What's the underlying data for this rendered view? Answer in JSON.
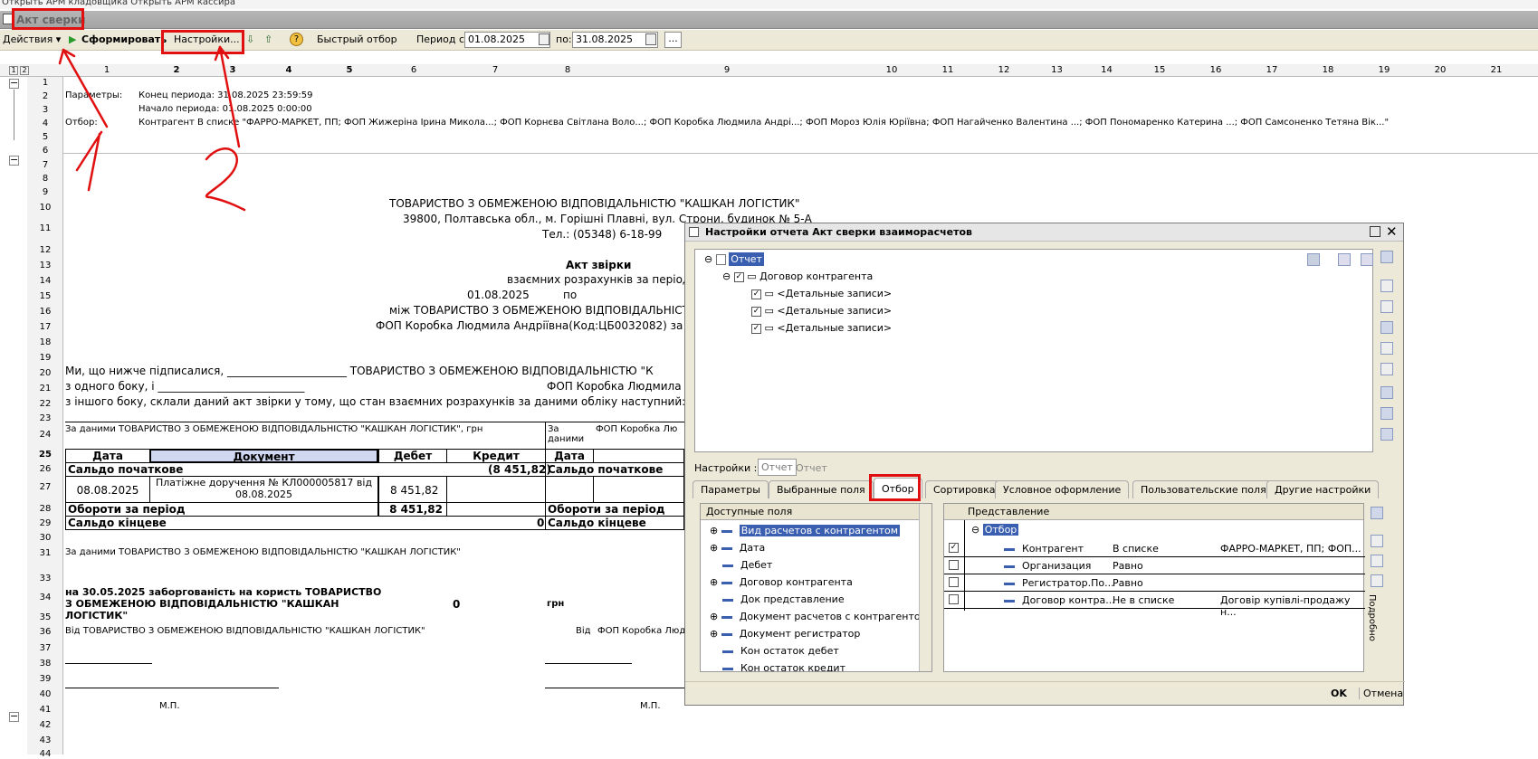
{
  "topbar": {
    "text": "Открыть АРМ кладовщика  Открыть АРМ кассира"
  },
  "window": {
    "title": "Акт сверки"
  },
  "toolbar": {
    "actions": "Действия",
    "form": "Сформировать",
    "settings": "Настройки...",
    "help": "?",
    "quick_filter": "Быстрый отбор",
    "period_from_label": "Период с:",
    "period_from": "01.08.2025",
    "period_to_label": "по:",
    "period_to": "31.08.2025",
    "more": "..."
  },
  "columns": [
    "1",
    "2",
    "3",
    "4",
    "5",
    "6",
    "7",
    "8",
    "9",
    "10",
    "11",
    "12",
    "13",
    "14",
    "15",
    "16",
    "17",
    "18",
    "19",
    "20",
    "21"
  ],
  "outline_levels": [
    "1",
    "2"
  ],
  "rows": [
    "1",
    "2",
    "3",
    "4",
    "5",
    "6",
    "7",
    "8",
    "9",
    "10",
    "11",
    "12",
    "13",
    "14",
    "15",
    "16",
    "17",
    "18",
    "19",
    "20",
    "21",
    "22",
    "23",
    "24",
    "25",
    "26",
    "27",
    "28",
    "29",
    "30",
    "31",
    "33",
    "34",
    "35",
    "36",
    "37",
    "38",
    "39",
    "40",
    "41",
    "42",
    "43",
    "44"
  ],
  "params": {
    "label": "Параметры:",
    "end": "Конец периода: 31.08.2025 23:59:59",
    "start": "Начало периода: 01.08.2025 0:00:00",
    "filter_label": "Отбор:",
    "filter": "Контрагент В списке \"ФАРРО-МАРКЕТ, ПП; ФОП Жижеріна Ірина Микола...; ФОП Корнєва Світлана Воло...; ФОП Коробка Людмила Андрі...; ФОП Мороз Юлія Юріївна; ФОП Нагайченко Валентина ...; ФОП Пономаренко Катерина ...; ФОП Самсоненко Тетяна Вік...\""
  },
  "doc": {
    "company": "ТОВАРИСТВО З ОБМЕЖЕНОЮ ВІДПОВІДАЛЬНІСТЮ \"КАШКАН ЛОГІСТИК\"",
    "address": "39800, Полтавська обл., м. Горішні Плавні, вул. Строни, будинок № 5-А",
    "phone": "Тел.: (05348) 6-18-99",
    "act_title": "Акт звірки",
    "act_sub": "взаємних розрахунків за період",
    "date_from": "01.08.2025",
    "date_to": "по",
    "between": "між ТОВАРИСТВО З ОБМЕЖЕНОЮ ВІДПОВІДАЛЬНІСТ",
    "counterparty": "ФОП Коробка Людмила Андріївна(Код:ЦБ0032082) за д",
    "para1a": "Ми, що нижче підписалися, ______________________ ТОВАРИСТВО З ОБМЕЖЕНОЮ ВІДПОВІДАЛЬНІСТЮ \"К",
    "para1b": " з одного боку, і ___________________________",
    "para1c": "ФОП Коробка Людмила А",
    "para1d": "з іншого боку, склали даний акт звірки у тому, що стан взаємних розрахунків за даними обліку наступний:",
    "left_hdr": "За даними ТОВАРИСТВО З ОБМЕЖЕНОЮ ВІДПОВІДАЛЬНІСТЮ \"КАШКАН ЛОГІСТИК\", грн",
    "right_hdr_a": "За даними",
    "right_hdr_b": "ФОП Коробка Лю",
    "col_date": "Дата",
    "col_doc": "Документ",
    "col_debit": "Дебет",
    "col_credit": "Кредит",
    "col_date2": "Дата",
    "saldo_start": "Сальдо початкове",
    "saldo_start_credit": "(8 451,82)",
    "row_date": "08.08.2025",
    "row_doc": "Платіжне доручення  № КЛ000005817 від 08.08.2025",
    "row_debit": "8 451,82",
    "turnover": "Обороти за період",
    "turnover_debit": "8 451,82",
    "saldo_end": "Сальдо кінцеве",
    "saldo_end_credit": "0",
    "by_data": "За даними ТОВАРИСТВО З ОБМЕЖЕНОЮ ВІДПОВІДАЛЬНІСТЮ \"КАШКАН ЛОГІСТИК\"",
    "debt": "на 30.05.2025 заборгованість на користь ТОВАРИСТВО З ОБМЕЖЕНОЮ ВІДПОВІДАЛЬНІСТЮ \"КАШКАН ЛОГІСТИК\"",
    "debt_val": "0",
    "debt_cur": "грн",
    "from_left": "Від ТОВАРИСТВО З ОБМЕЖЕНОЮ ВІДПОВІДАЛЬНІСТЮ \"КАШКАН ЛОГІСТИК\"",
    "from_right_a": "Від",
    "from_right_b": "ФОП Коробка Людм",
    "mp": "М.П.",
    "mp2": "М.П."
  },
  "dialog": {
    "title": "Настройки отчета  Акт сверки взаиморасчетов",
    "tree_root": "Отчет",
    "tree_group": "Договор контрагента",
    "tree_items": [
      "<Детальные записи>",
      "<Детальные записи>",
      "<Детальные записи>"
    ],
    "settings_label": "Настройки :",
    "settings_btn": "Отчет",
    "settings_val": "Отчет",
    "tabs": [
      "Параметры",
      "Выбранные поля",
      "Отбор",
      "Сортировка",
      "Условное оформление",
      "Пользовательские поля",
      "Другие настройки"
    ],
    "avail_header": "Доступные поля",
    "avail_fields": [
      "Вид расчетов с контрагентом",
      "Дата",
      "Дебет",
      "Договор контрагента",
      "Док представление",
      "Документ расчетов с контрагентом",
      "Документ регистратор",
      "Кон остаток дебет",
      "Кон остаток кредит"
    ],
    "repr_header": "Представление",
    "filter_root": "Отбор",
    "filters": [
      {
        "name": "Контрагент",
        "cond": "В списке",
        "value": "ФАРРО-МАРКЕТ, ПП; ФОП..."
      },
      {
        "name": "Организация",
        "cond": "Равно",
        "value": ""
      },
      {
        "name": "Регистратор.По...",
        "cond": "Равно",
        "value": ""
      },
      {
        "name": "Договор контра...",
        "cond": "Не в списке",
        "value": "Договір купівлі-продажу н..."
      }
    ],
    "side_label": "Подробно",
    "ok": "OK",
    "cancel": "Отмена"
  },
  "annotations": {
    "one": "1",
    "two": "2",
    "three": "3"
  },
  "colors": {
    "highlight": "#3a5fb0",
    "annotation": "#e01010"
  }
}
